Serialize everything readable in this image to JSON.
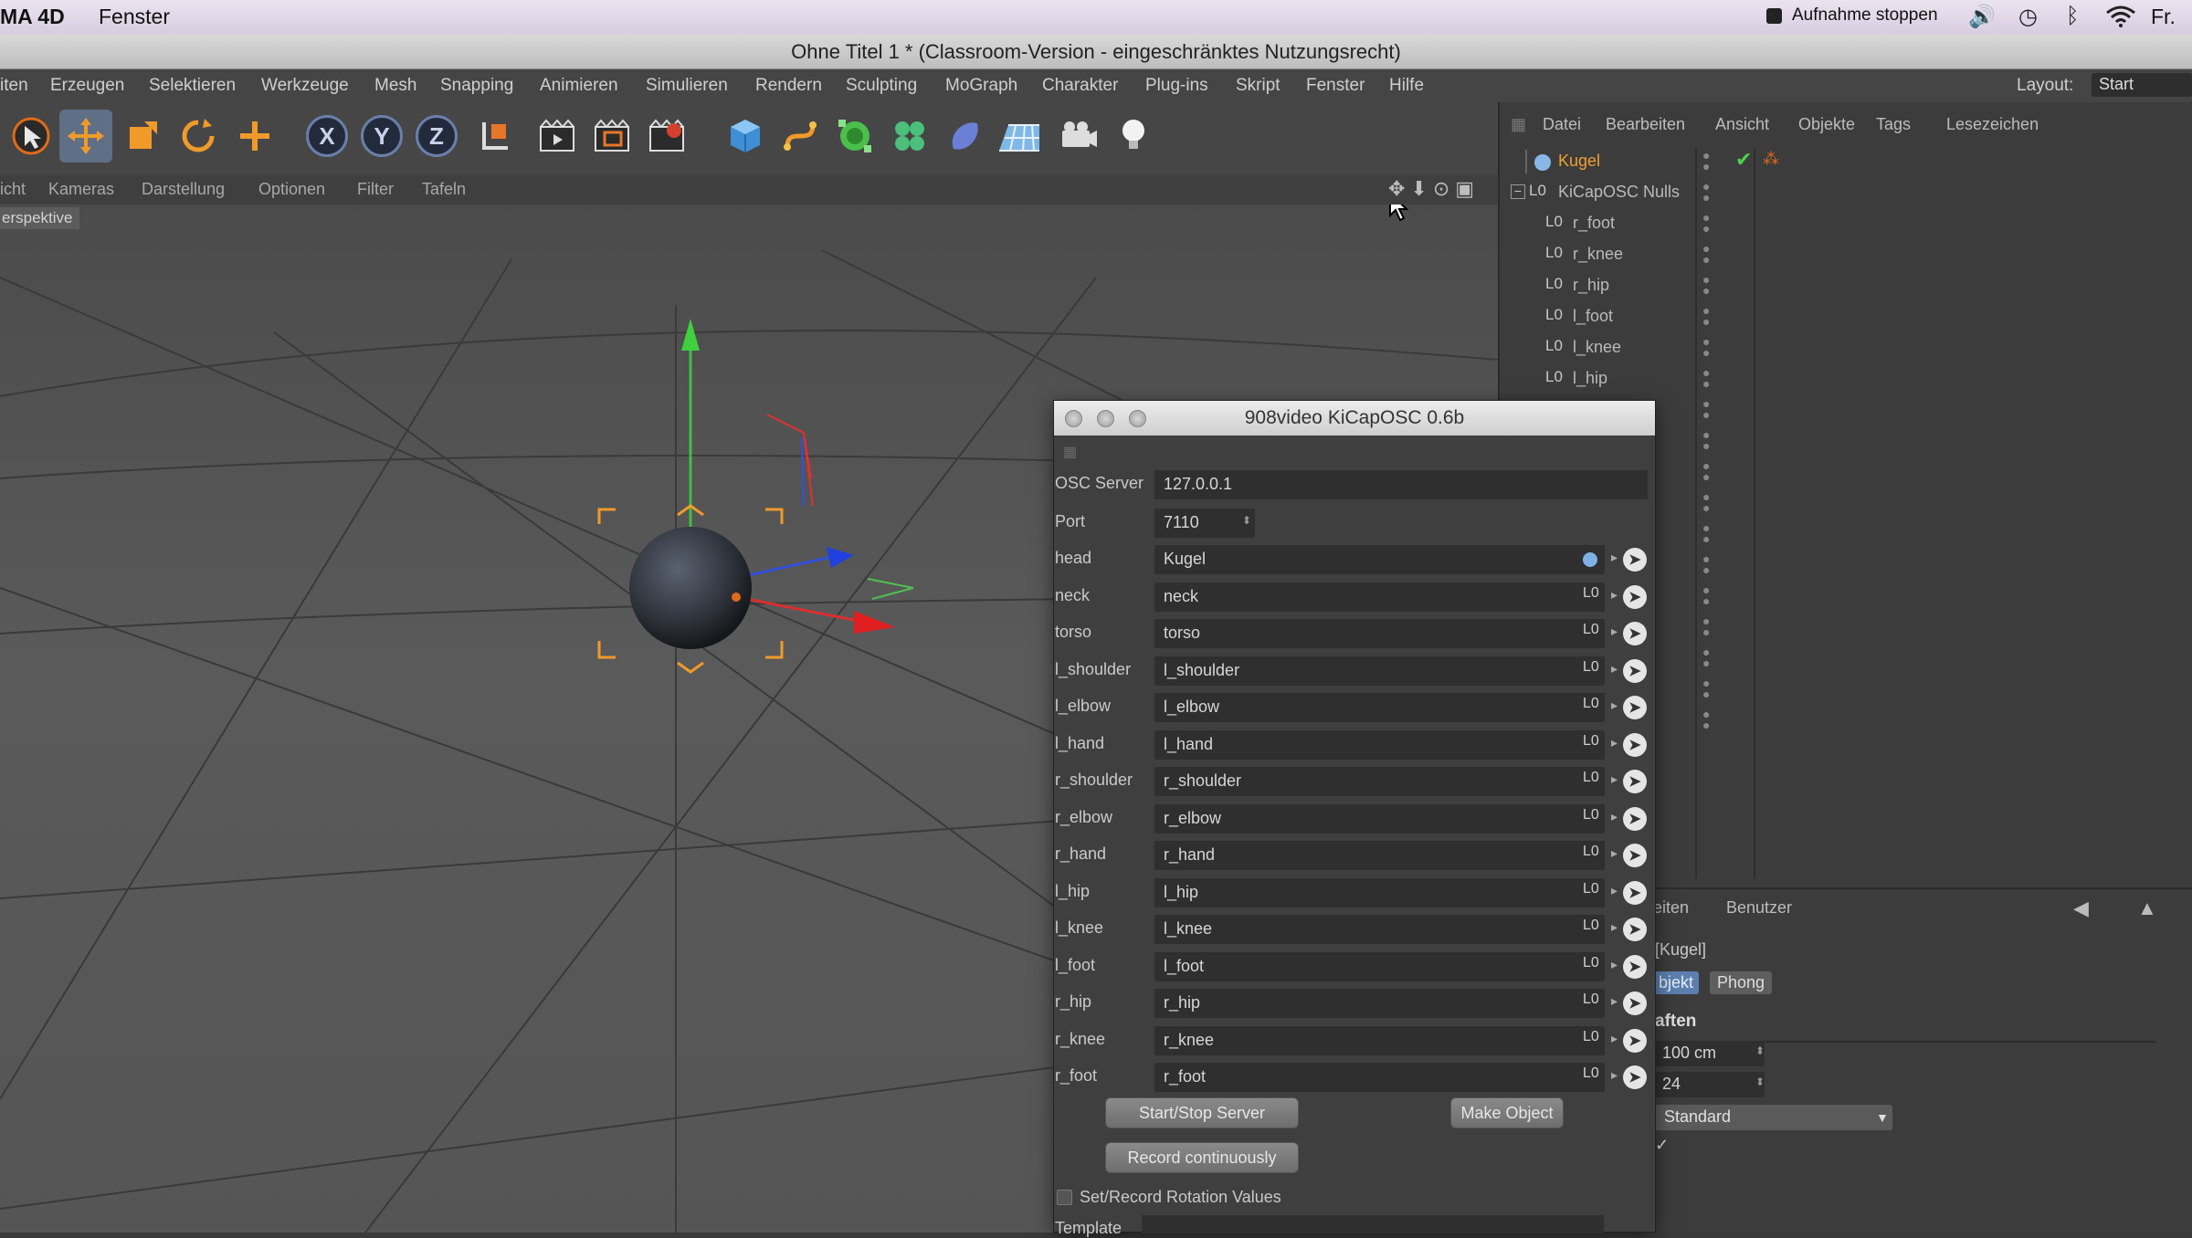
{
  "macbar": {
    "app_name": "MA 4D",
    "menu_fenster": "Fenster",
    "record_label": "Aufnahme stoppen",
    "volume_icon": "🔊",
    "clock_icon": "◷",
    "bluetooth_icon": "ᛒ",
    "wifi_icon": "wifi-icon",
    "user": "Fr."
  },
  "window": {
    "title": "Ohne Titel 1 * (Classroom-Version - eingeschränktes Nutzungsrecht)"
  },
  "mainmenu": {
    "items": [
      "iten",
      "Erzeugen",
      "Selektieren",
      "Werkzeuge",
      "Mesh",
      "Snapping",
      "Animieren",
      "Simulieren",
      "Rendern",
      "Sculpting",
      "MoGraph",
      "Charakter",
      "Plug-ins",
      "Skript",
      "Fenster",
      "Hilfe"
    ],
    "layout_label": "Layout:",
    "layout_value": "Start"
  },
  "toolbar": {
    "axis_x": "X",
    "axis_y": "Y",
    "axis_z": "Z"
  },
  "viewport": {
    "menu": [
      "icht",
      "Kameras",
      "Darstellung",
      "Optionen",
      "Filter",
      "Tafeln"
    ],
    "view_label": "erspektive"
  },
  "objmgr": {
    "menu": [
      "Datei",
      "Bearbeiten",
      "Ansicht",
      "Objekte",
      "Tags",
      "Lesezeichen"
    ],
    "objects": [
      {
        "name": "Kugel",
        "selected": true
      },
      {
        "name": "KiCapOSC Nulls"
      },
      {
        "name": "r_foot"
      },
      {
        "name": "r_knee"
      },
      {
        "name": "r_hip"
      },
      {
        "name": "l_foot"
      },
      {
        "name": "l_knee"
      },
      {
        "name": "l_hip"
      }
    ]
  },
  "attr": {
    "tab_edit": "eiten",
    "tab_user": "Benutzer",
    "object_name": "[Kugel]",
    "tab_objekt": "bjekt",
    "tab_phong": "Phong",
    "section": "aften",
    "radius": "100 cm",
    "segments": "24",
    "type": "Standard"
  },
  "dialog": {
    "title": "908video KiCapOSC 0.6b",
    "osc_label": "OSC Server",
    "osc_value": "127.0.0.1",
    "port_label": "Port",
    "port_value": "7110",
    "joints": [
      {
        "label": "head",
        "value": "Kugel"
      },
      {
        "label": "neck",
        "value": "neck"
      },
      {
        "label": "torso",
        "value": "torso"
      },
      {
        "label": "l_shoulder",
        "value": "l_shoulder"
      },
      {
        "label": "l_elbow",
        "value": "l_elbow"
      },
      {
        "label": "l_hand",
        "value": "l_hand"
      },
      {
        "label": "r_shoulder",
        "value": "r_shoulder"
      },
      {
        "label": "r_elbow",
        "value": "r_elbow"
      },
      {
        "label": "r_hand",
        "value": "r_hand"
      },
      {
        "label": "l_hip",
        "value": "l_hip"
      },
      {
        "label": "l_knee",
        "value": "l_knee"
      },
      {
        "label": "l_foot",
        "value": "l_foot"
      },
      {
        "label": "r_hip",
        "value": "r_hip"
      },
      {
        "label": "r_knee",
        "value": "r_knee"
      },
      {
        "label": "r_foot",
        "value": "r_foot"
      }
    ],
    "btn_server": "Start/Stop Server",
    "btn_make": "Make Object",
    "btn_record": "Record continuously",
    "checkbox_label": "Set/Record Rotation Values",
    "template_label": "Template"
  }
}
